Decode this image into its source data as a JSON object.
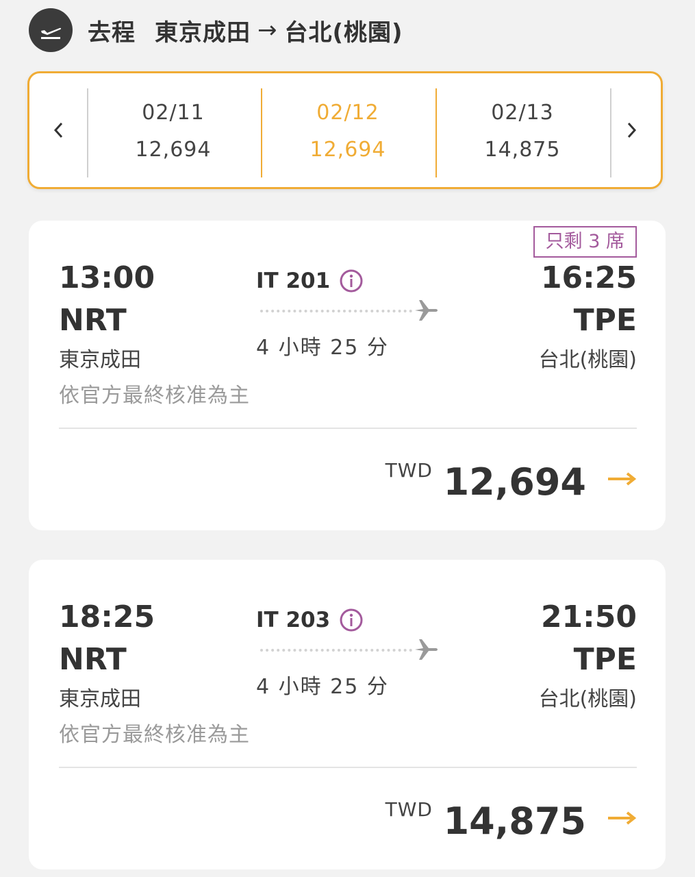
{
  "header": {
    "icon": "plane-departure-icon",
    "label": "去程",
    "origin": "東京成田",
    "arrow": "→",
    "destination": "台北(桃園)"
  },
  "date_selector": {
    "prev_icon": "chevron-left-icon",
    "next_icon": "chevron-right-icon",
    "accent_color": "#f0ac35",
    "dates": [
      {
        "date": "02/11",
        "price": "12,694",
        "selected": false
      },
      {
        "date": "02/12",
        "price": "12,694",
        "selected": true
      },
      {
        "date": "02/13",
        "price": "14,875",
        "selected": false
      }
    ]
  },
  "flights": [
    {
      "seats_left": "只剩 3 席",
      "dep_time": "13:00",
      "dep_code": "NRT",
      "dep_city": "東京成田",
      "note": "依官方最終核准為主",
      "flight_no": "IT 201",
      "duration": "4 小時 25 分",
      "arr_time": "16:25",
      "arr_code": "TPE",
      "arr_city": "台北(桃園)",
      "currency": "TWD",
      "price": "12,694"
    },
    {
      "seats_left": "",
      "dep_time": "18:25",
      "dep_code": "NRT",
      "dep_city": "東京成田",
      "note": "依官方最終核准為主",
      "flight_no": "IT 203",
      "duration": "4 小時 25 分",
      "arr_time": "21:50",
      "arr_code": "TPE",
      "arr_city": "台北(桃園)",
      "currency": "TWD",
      "price": "14,875"
    }
  ],
  "colors": {
    "accent": "#f0ac35",
    "badge": "#a35a9c",
    "info": "#a35a9c"
  }
}
